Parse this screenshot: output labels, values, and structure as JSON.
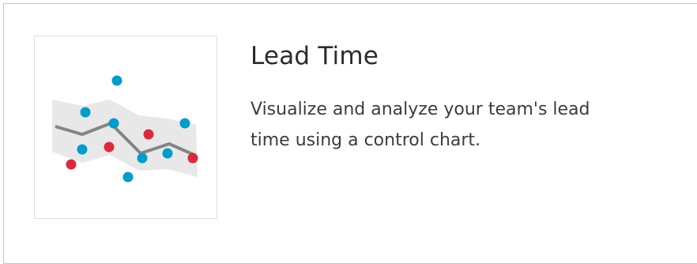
{
  "widget": {
    "title": "Lead Time",
    "description_lines": [
      "Visualize and analyze your team's lead",
      "time using a control chart."
    ],
    "thumbnail_icon": "control-chart-icon"
  },
  "colors": {
    "band": "#e8e8e8",
    "trend_line": "#858585",
    "point_blue": "#009ccc",
    "point_red": "#da2b3c",
    "border": "#c6c6c6"
  }
}
